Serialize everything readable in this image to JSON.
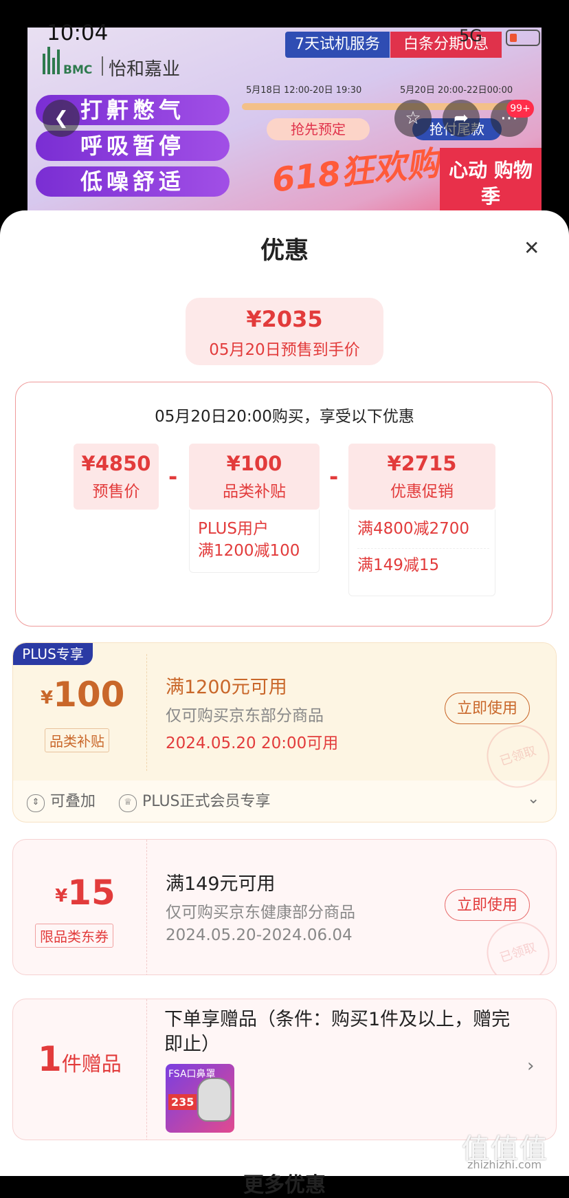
{
  "status_bar": {
    "time": "10:04",
    "network": "5G"
  },
  "banner": {
    "brand_small": "怡和嘉业",
    "brand_code": "BMC",
    "brand_name": "怡和嘉业",
    "feature_pills": [
      "打鼾憋气",
      "呼吸暂停",
      "低噪舒适"
    ],
    "tag_trial": "7天试机服务",
    "tag_installment": "白条分期0息",
    "date_1": "5月18日 12:00-20日 19:30",
    "date_2": "5月20日 20:00-22日00:00",
    "btn_presale": "抢先预定",
    "btn_rush": "抢付尾款",
    "promo_text": "618狂欢购",
    "promo_side": "心动 购物季",
    "cart_badge": "99+"
  },
  "sheet": {
    "title": "优惠",
    "final_price": "¥2035",
    "final_price_label": "05月20日预售到手价",
    "calc_title": "05月20日20:00购买，享受以下优惠",
    "calc_items": [
      {
        "value": "¥4850",
        "label": "预售价"
      },
      {
        "value": "¥100",
        "label": "品类补贴"
      },
      {
        "value": "¥2715",
        "label": "优惠促销"
      }
    ],
    "minus_sign": "-",
    "subsidy_detail": [
      "PLUS用户",
      "满1200减100"
    ],
    "promo_detail": [
      "满4800减2700",
      "满149减15"
    ]
  },
  "coupons": [
    {
      "tag": "PLUS专享",
      "yen": "¥",
      "amount": "100",
      "type_label": "品类补贴",
      "title": "满1200元可用",
      "scope": "仅可购买京东部分商品",
      "date": "2024.05.20 20:00可用",
      "button": "立即使用",
      "stamp": "已领取",
      "foot_stack": "可叠加",
      "foot_member": "PLUS正式会员专享"
    },
    {
      "yen": "¥",
      "amount": "15",
      "type_label": "限品类东券",
      "title": "满149元可用",
      "scope": "仅可购买京东健康部分商品",
      "date": "2024.05.20-2024.06.04",
      "button": "立即使用",
      "stamp": "已领取"
    }
  ],
  "gift": {
    "count": "1",
    "count_unit": "件赠品",
    "title": "下单享赠品（条件：购买1件及以上，赠完即止）",
    "image_price": "235",
    "image_brand": "FSA口鼻罩"
  },
  "bottom_peek": "更多优惠",
  "watermark": "值值值",
  "watermark_url": "zhizhizhi.com",
  "colors": {
    "accent_red": "#e23b3b",
    "plus_blue": "#2b3aa4",
    "gold": "#d8752f"
  }
}
